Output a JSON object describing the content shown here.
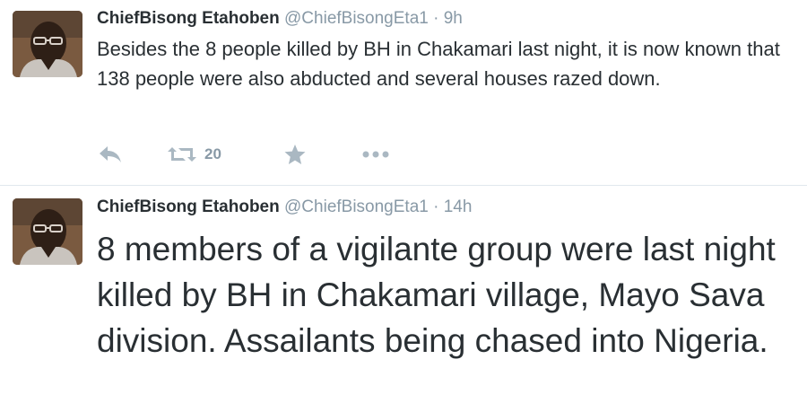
{
  "tweets": [
    {
      "author_name": "ChiefBisong Etahoben",
      "author_handle": "@ChiefBisongEta1",
      "separator": "·",
      "timestamp": "9h",
      "text": "Besides the 8 people killed by BH in Chakamari last night, it is now known that 138 people were also abducted and several houses razed down.",
      "retweet_count": "20",
      "icons": [
        "reply-icon",
        "retweet-icon",
        "favorite-icon",
        "more-icon"
      ]
    },
    {
      "author_name": "ChiefBisong Etahoben",
      "author_handle": "@ChiefBisongEta1",
      "separator": "·",
      "timestamp": "14h",
      "text": "8 members of a vigilante group were last night killed by BH in Chakamari village, Mayo Sava division. Assailants being chased into Nigeria."
    }
  ],
  "colors": {
    "text": "#292f33",
    "muted": "#8899a6",
    "icon": "#aab8c2",
    "divider": "#e1e8ed"
  }
}
